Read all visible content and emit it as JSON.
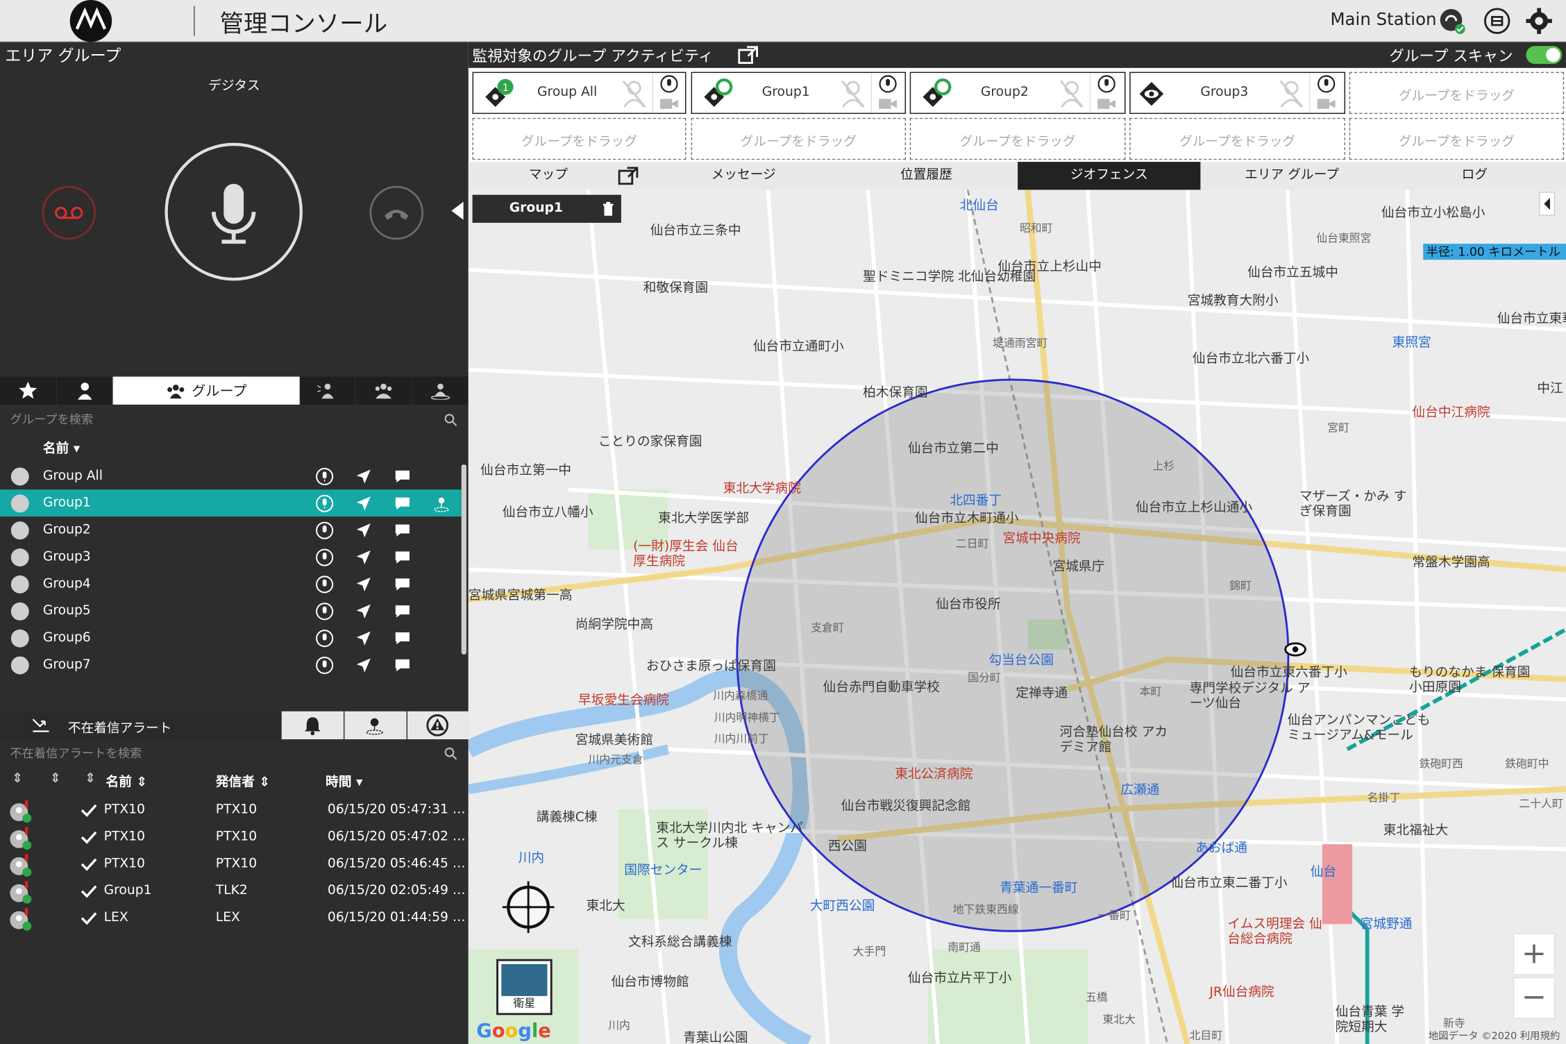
{
  "header": {
    "app_title": "管理コンソール",
    "station_name": "Main Station"
  },
  "left": {
    "panel_title": "エリア グループ",
    "call_target": "デジタス",
    "tabs": {
      "groups_label": "グループ"
    },
    "search_placeholder": "グループを検索",
    "column_name": "名前",
    "groups": [
      "Group All",
      "Group1",
      "Group2",
      "Group3",
      "Group4",
      "Group5",
      "Group6",
      "Group7"
    ],
    "selected_group": "Group1",
    "alerts": {
      "title": "不在着信アラート",
      "search_placeholder": "不在着信アラートを検索",
      "col_name": "名前",
      "col_sender": "発信者",
      "col_time": "時間",
      "rows": [
        {
          "name": "PTX10",
          "sender": "PTX10",
          "time": "06/15/20 05:47:31 …"
        },
        {
          "name": "PTX10",
          "sender": "PTX10",
          "time": "06/15/20 05:47:02 …"
        },
        {
          "name": "PTX10",
          "sender": "PTX10",
          "time": "06/15/20 05:46:45 …"
        },
        {
          "name": "Group1",
          "sender": "TLK2",
          "time": "06/15/20 02:05:49 …"
        },
        {
          "name": "LEX",
          "sender": "LEX",
          "time": "06/15/20 01:44:59 …"
        }
      ]
    }
  },
  "right": {
    "title": "監視対象のグループ アクティビティ",
    "scan_label": "グループ スキャン",
    "scan_on": true,
    "cards": [
      {
        "name": "Group All",
        "badge": "1"
      },
      {
        "name": "Group1"
      },
      {
        "name": "Group2"
      },
      {
        "name": "Group3"
      }
    ],
    "drag_label": "グループをドラッグ",
    "nav_tabs": [
      "マップ",
      "メッセージ",
      "位置履歴",
      "ジオフェンス",
      "エリア グループ",
      "ログ"
    ],
    "active_tab": "ジオフェンス",
    "map": {
      "geofence_group": "Group1",
      "radius_label": "半径: 1.00 キロメートル",
      "satellite_label": "衛星",
      "copyright": "地図データ ©2020    利用規約",
      "labels": [
        "北仙台",
        "仙台市立三条中",
        "昭和町",
        "仙台市立上杉山中",
        "仙台市立小松島小",
        "仙台東照宮",
        "仙台市立五城中",
        "和敬保育園",
        "聖ドミニコ学院 北仙台幼稚園",
        "宮城教育大附小",
        "仙台市立東華",
        "仙台市立通町小",
        "堤通雨宮町",
        "仙台市立北六番丁小",
        "東照宮",
        "中江",
        "柏木保育園",
        "仙台中江病院",
        "ことりの家保育園",
        "仙台市立第二中",
        "宮町",
        "仙台市立第一中",
        "上杉",
        "東北大学病院",
        "北四番丁",
        "仙台市立上杉山通小",
        "マザーズ・かみ すぎ保育園",
        "仙台市立八幡小",
        "東北大学医学部",
        "仙台市立木町通小",
        "宮城中央病院",
        "(一財)厚生会 仙台厚生病院",
        "二日町",
        "宮城県庁",
        "常盤木学園高",
        "宮城県宮城第一高",
        "仙台市役所",
        "錦町",
        "尚絅学院中高",
        "支倉町",
        "勾当台公園",
        "仙台市立東六番丁小",
        "もりのなかま 保育園 小田原園",
        "おひさま原っぱ保育園",
        "仙台赤門自動車学校",
        "国分町",
        "本町",
        "専門学校デジタル アーツ仙台",
        "早坂愛生会病院",
        "川内森橋通",
        "定禅寺通",
        "仙台アンパンマンこども ミュージアム&モール",
        "川内明神横丁",
        "河合塾仙台校 アカデミア館",
        "宮城県美術館",
        "川内川前丁",
        "川内元支倉",
        "東北公済病院",
        "鉄砲町西",
        "鉄砲町中",
        "広瀬通",
        "名掛丁",
        "二十人町",
        "講義棟C棟",
        "仙台市戦災復興記念館",
        "東北福祉大",
        "東北大学川内北 キャンパス サークル棟",
        "西公園",
        "あおば通",
        "川内",
        "国際センター",
        "青葉通一番町",
        "仙台市立東二番丁小",
        "仙台",
        "大町西公園",
        "地下鉄東西線",
        "一番町",
        "宮城野通",
        "東北大",
        "イムス明理会 仙台総合病院",
        "文科系総合講義棟",
        "大手門",
        "南町通",
        "仙台市博物館",
        "仙台市立片平丁小",
        "JR仙台病院",
        "五橋",
        "仙台青葉 学院短期大",
        "青葉山公園",
        "東北大",
        "川内",
        "北目町",
        "新寺"
      ]
    }
  },
  "colors": {
    "teal": "#15a8a5",
    "dark": "#2d2d2d",
    "geofence_stroke": "#2a2ad0",
    "toggle_green": "#56c24d",
    "radius_blue": "#37a6e3"
  }
}
